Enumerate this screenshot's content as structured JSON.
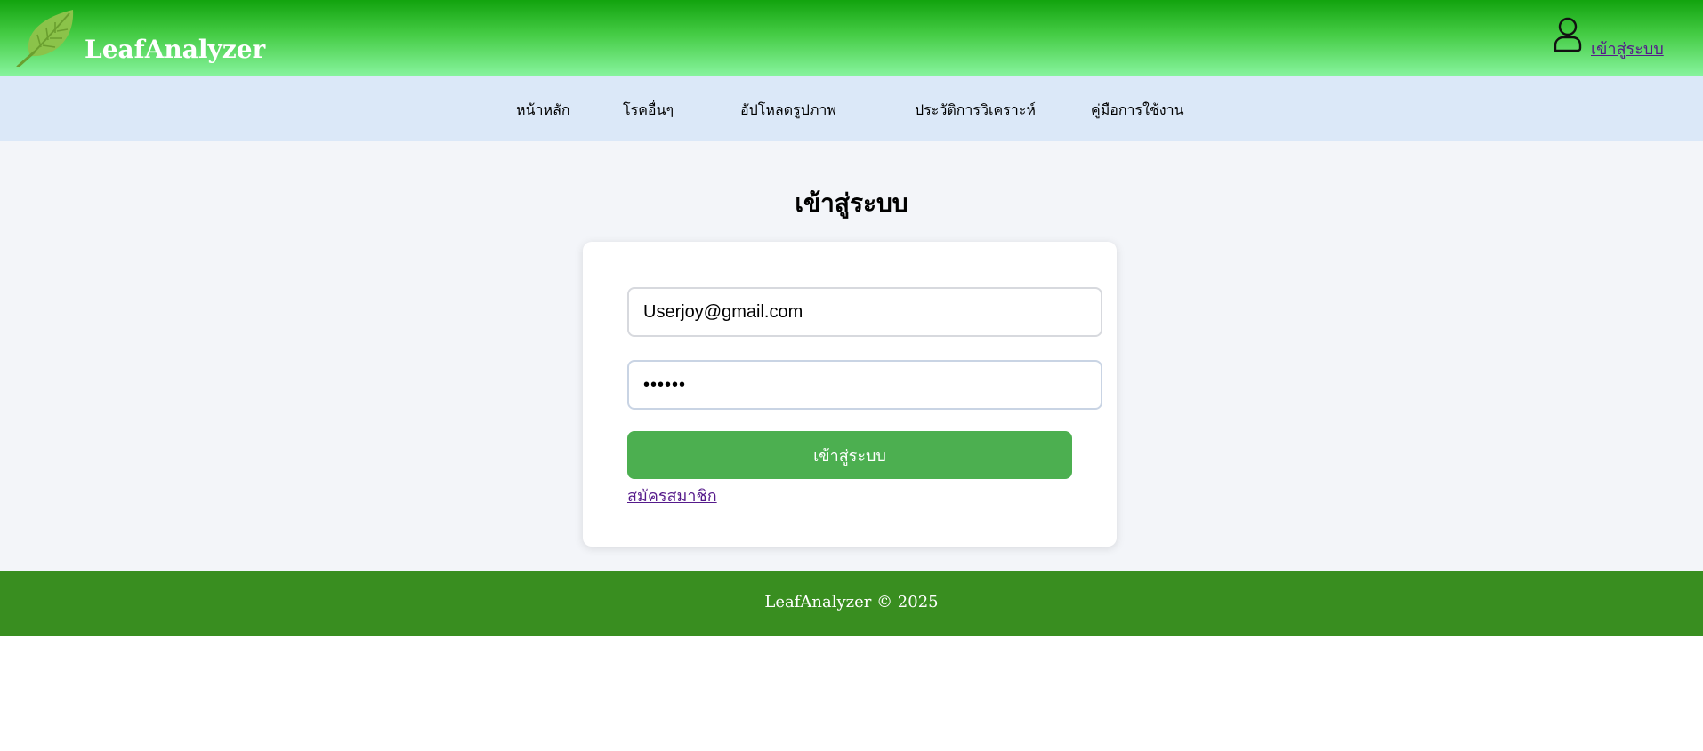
{
  "header": {
    "brand": "LeafAnalyzer",
    "login_link": "เข้าสู่ระบบ",
    "logo_icon": "leaf-icon",
    "user_icon": "user-icon"
  },
  "nav": {
    "items": [
      "หน้าหลัก",
      "โรคอื่นๆ",
      "อัปโหลดรูปภาพ",
      "ประวัติการวิเคราะห์",
      "คู่มือการใช้งาน"
    ]
  },
  "main": {
    "title": "เข้าสู่ระบบ",
    "form": {
      "email_value": "Userjoy@gmail.com",
      "password_value": "••••••",
      "submit_label": "เข้าสู่ระบบ",
      "register_link": "สมัครสมาชิก"
    }
  },
  "footer": {
    "text": "LeafAnalyzer © 2025"
  },
  "colors": {
    "header_top": "#12a30e",
    "header_bottom": "#88f49f",
    "nav_bg": "#dbe8f8",
    "main_bg": "#f3f5f9",
    "button": "#4caf50",
    "footer": "#398e20",
    "link": "#551a8b"
  }
}
